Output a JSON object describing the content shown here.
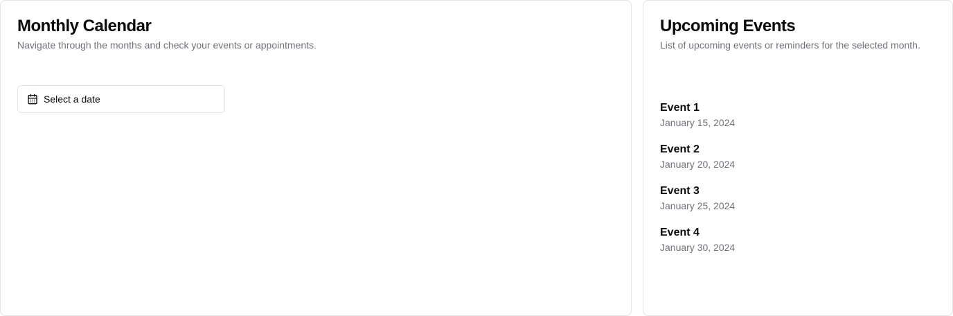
{
  "calendar": {
    "title": "Monthly Calendar",
    "description": "Navigate through the months and check your events or appointments.",
    "date_picker": {
      "icon": "calendar-icon",
      "label": "Select a date"
    }
  },
  "events": {
    "title": "Upcoming Events",
    "description": "List of upcoming events or reminders for the selected month.",
    "items": [
      {
        "name": "Event 1",
        "date": "January 15, 2024"
      },
      {
        "name": "Event 2",
        "date": "January 20, 2024"
      },
      {
        "name": "Event 3",
        "date": "January 25, 2024"
      },
      {
        "name": "Event 4",
        "date": "January 30, 2024"
      }
    ]
  },
  "colors": {
    "text": "#0a0a0a",
    "muted": "#71717a",
    "border": "#e4e4e7"
  }
}
